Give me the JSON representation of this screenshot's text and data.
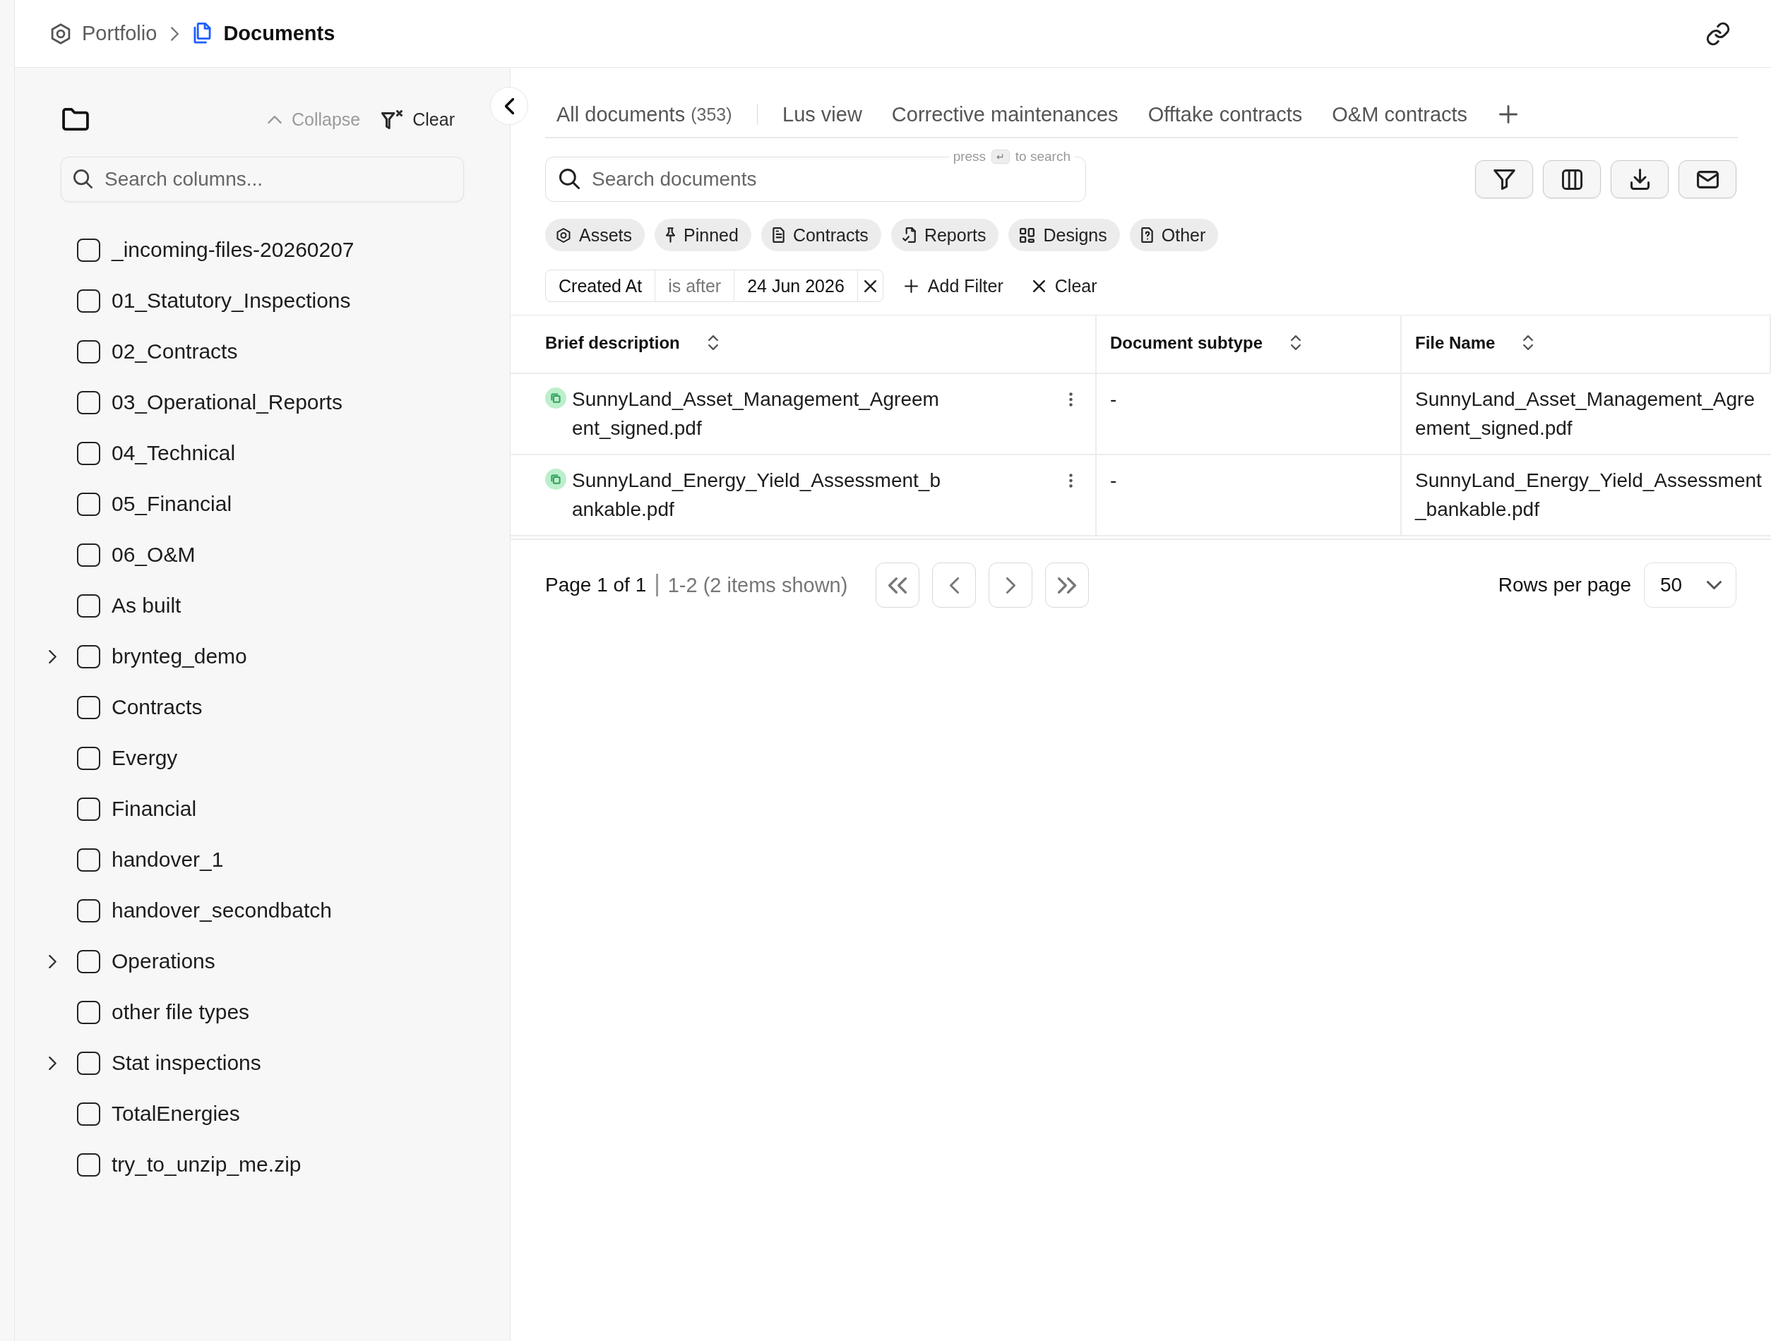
{
  "breadcrumb": [
    {
      "label": "Portfolio",
      "kind": "portfolio",
      "current": false
    },
    {
      "label": "Documents",
      "kind": "documents",
      "current": true
    }
  ],
  "sidebar": {
    "actions": [
      {
        "label": "Collapse",
        "kind": "collapse",
        "disabled": true
      },
      {
        "label": "Clear",
        "kind": "clear",
        "disabled": false
      }
    ],
    "search": {
      "placeholder": "Search columns..."
    },
    "folders": [
      {
        "label": "_incoming-files-20260207",
        "checked": false,
        "expandable": false
      },
      {
        "label": "01_Statutory_Inspections",
        "checked": false,
        "expandable": false
      },
      {
        "label": "02_Contracts",
        "checked": false,
        "expandable": false
      },
      {
        "label": "03_Operational_Reports",
        "checked": false,
        "expandable": false
      },
      {
        "label": "04_Technical",
        "checked": false,
        "expandable": false
      },
      {
        "label": "05_Financial",
        "checked": false,
        "expandable": false
      },
      {
        "label": "06_O&M",
        "checked": false,
        "expandable": false
      },
      {
        "label": "As built",
        "checked": false,
        "expandable": false
      },
      {
        "label": "brynteg_demo",
        "checked": false,
        "expandable": true
      },
      {
        "label": "Contracts",
        "checked": false,
        "expandable": false
      },
      {
        "label": "Evergy",
        "checked": false,
        "expandable": false
      },
      {
        "label": "Financial",
        "checked": false,
        "expandable": false
      },
      {
        "label": "handover_1",
        "checked": false,
        "expandable": false
      },
      {
        "label": "handover_secondbatch",
        "checked": false,
        "expandable": false
      },
      {
        "label": "Operations",
        "checked": false,
        "expandable": true
      },
      {
        "label": "other file types",
        "checked": false,
        "expandable": false
      },
      {
        "label": "Stat inspections",
        "checked": false,
        "expandable": true
      },
      {
        "label": "TotalEnergies",
        "checked": false,
        "expandable": false
      },
      {
        "label": "try_to_unzip_me.zip",
        "checked": false,
        "expandable": false
      }
    ]
  },
  "tabs": [
    {
      "label": "All documents",
      "count": "(353)"
    },
    {
      "label": "Lus view"
    },
    {
      "label": "Corrective maintenances"
    },
    {
      "label": "Offtake contracts"
    },
    {
      "label": "O&M contracts"
    }
  ],
  "search": {
    "placeholder": "Search documents",
    "hint_prefix": "press",
    "hint_key": "↵",
    "hint_suffix": "to search"
  },
  "categories": [
    {
      "label": "Assets"
    },
    {
      "label": "Pinned"
    },
    {
      "label": "Contracts"
    },
    {
      "label": "Reports"
    },
    {
      "label": "Designs"
    },
    {
      "label": "Other"
    }
  ],
  "active_filter": {
    "field": "Created At",
    "operator": "is after",
    "value": "24 Jun 2026"
  },
  "filter_actions": [
    {
      "label": "Add Filter",
      "kind": "add"
    },
    {
      "label": "Clear",
      "kind": "clear"
    }
  ],
  "table": {
    "columns": [
      {
        "label": "Brief description"
      },
      {
        "label": "Document subtype"
      },
      {
        "label": "File Name"
      }
    ],
    "rows": [
      {
        "cells": [
          "SunnyLand_Asset_Management_Agreement_signed.pdf",
          "-",
          "SunnyLand_Asset_Management_Agreement_signed.pdf"
        ]
      },
      {
        "cells": [
          "SunnyLand_Energy_Yield_Assessment_bankable.pdf",
          "-",
          "SunnyLand_Energy_Yield_Assessment_bankable.pdf"
        ]
      }
    ]
  },
  "pagination": {
    "page": "Page 1 of 1",
    "range": "1-2 (2 items shown)",
    "rows_per_page_label": "Rows per page",
    "rows_per_page": "50"
  }
}
